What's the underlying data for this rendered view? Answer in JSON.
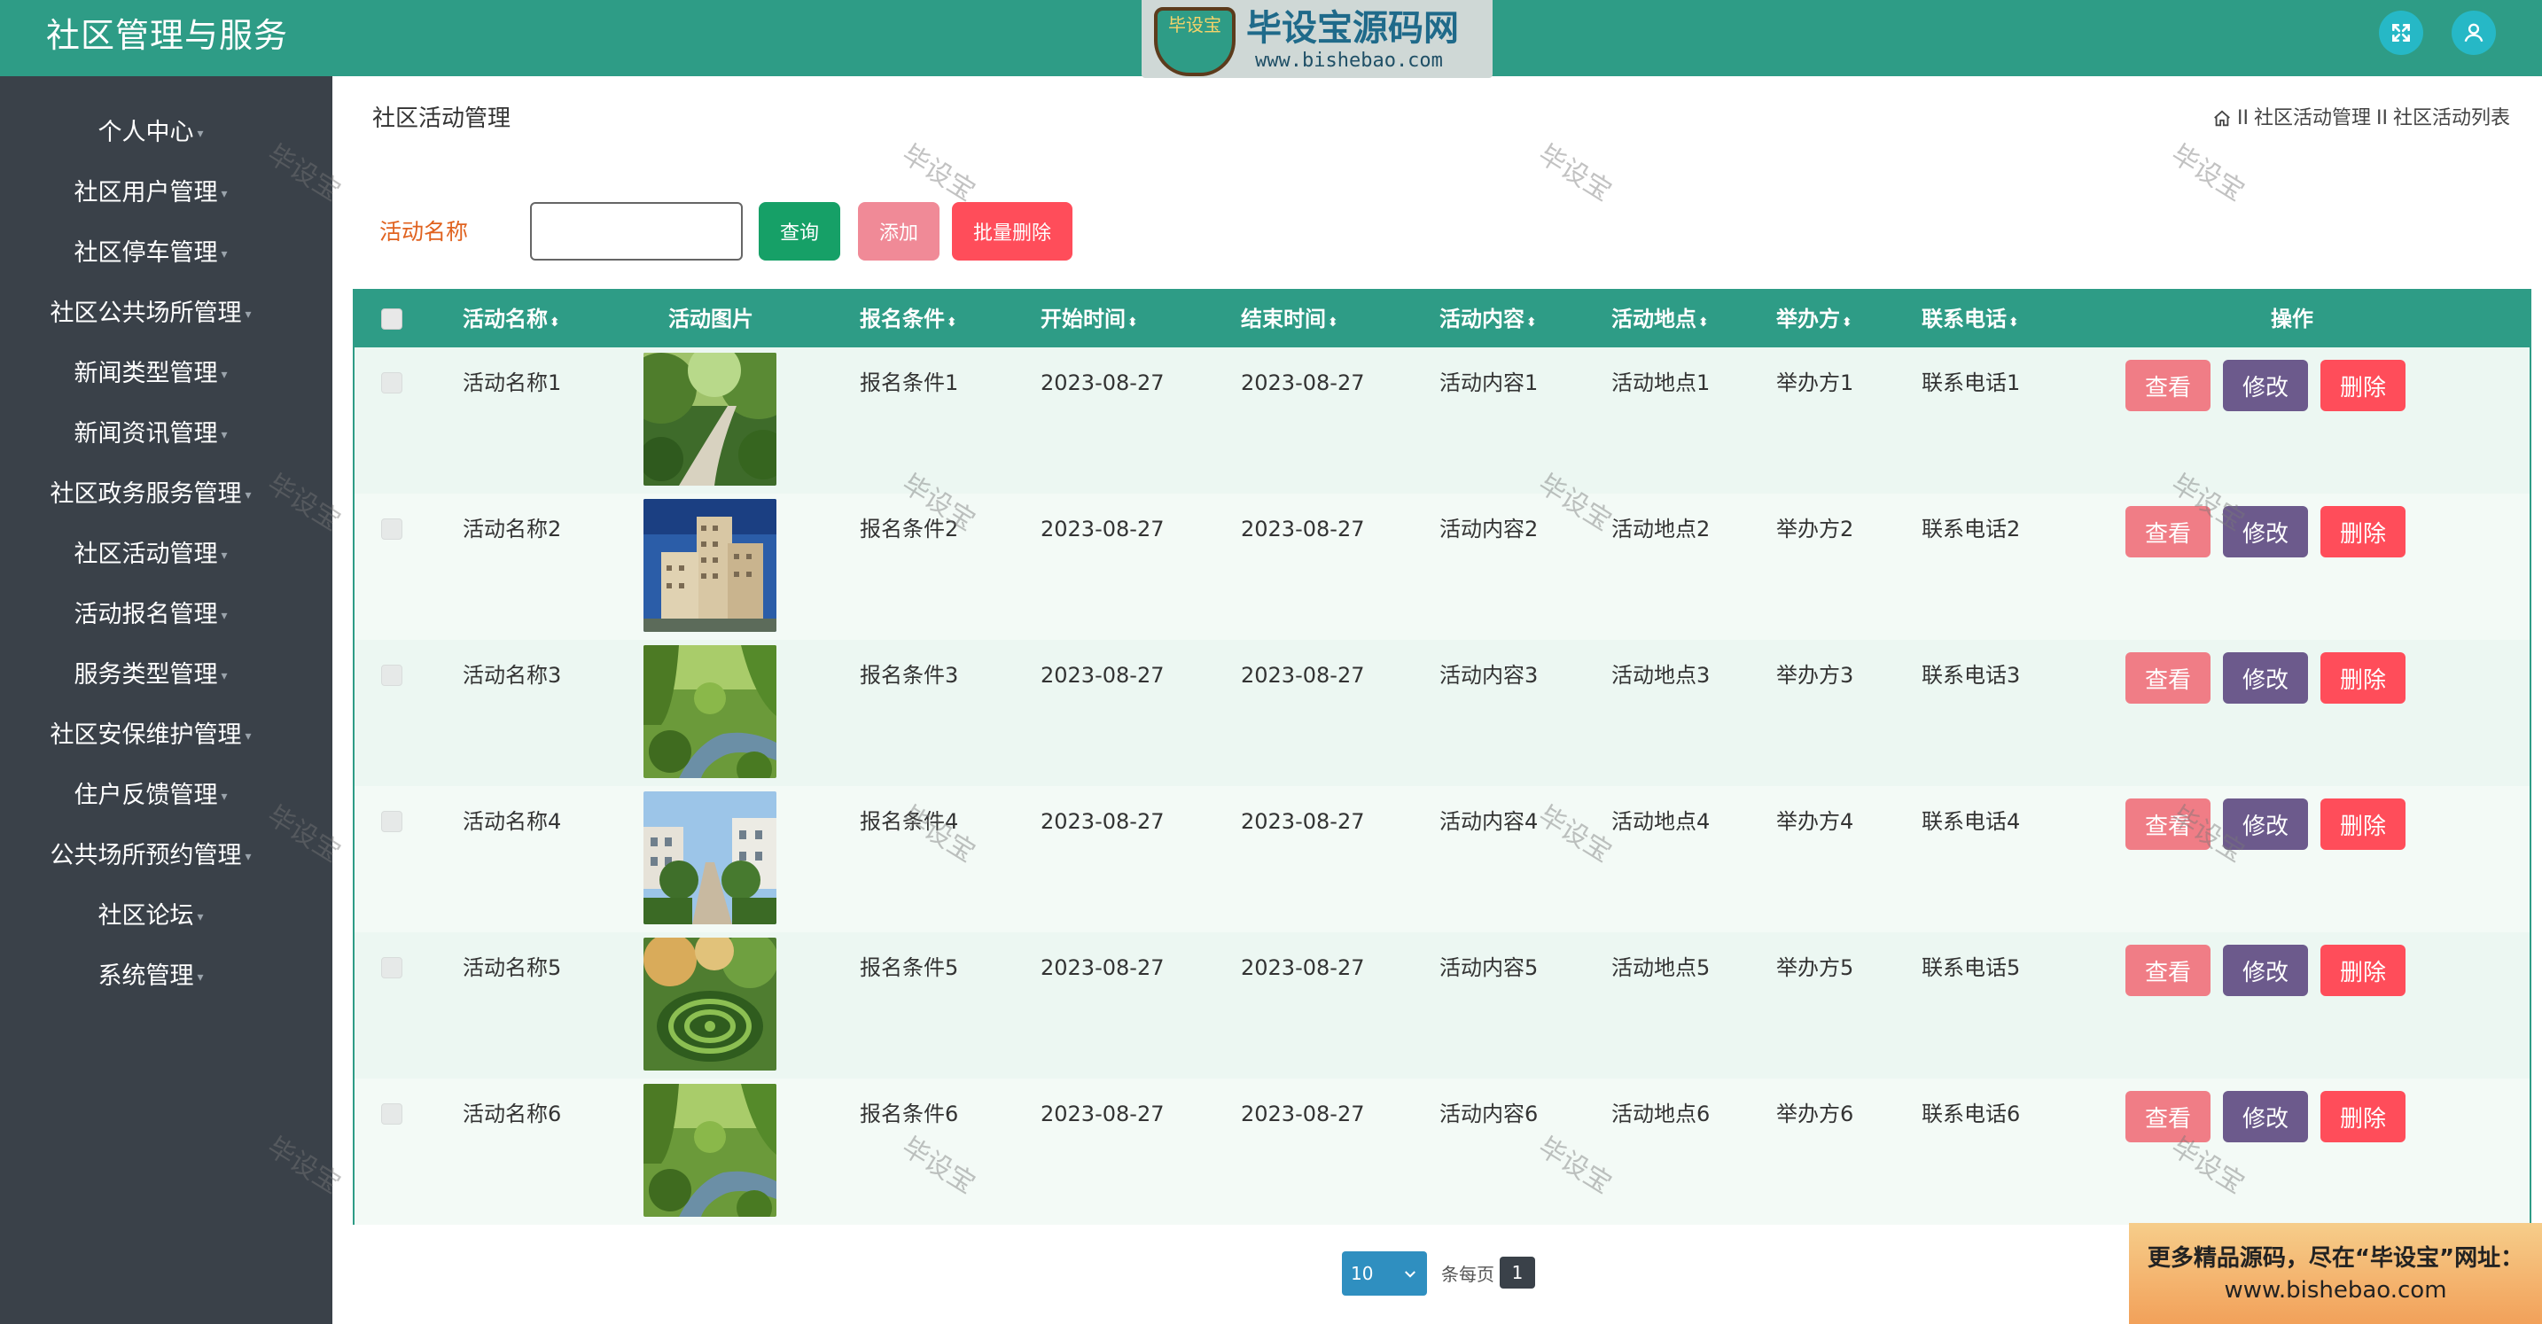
{
  "header": {
    "title": "社区管理与服务",
    "watermark_badge": "毕设宝",
    "watermark_name": "毕设宝源码网",
    "watermark_url": "www.bishebao.com",
    "fullscreen_icon": "expand-icon",
    "user_icon": "user-icon",
    "color": "#2e9c86"
  },
  "sidebar": {
    "items": [
      {
        "label": "个人中心"
      },
      {
        "label": "社区用户管理"
      },
      {
        "label": "社区停车管理"
      },
      {
        "label": "社区公共场所管理"
      },
      {
        "label": "新闻类型管理"
      },
      {
        "label": "新闻资讯管理"
      },
      {
        "label": "社区政务服务管理"
      },
      {
        "label": "社区活动管理"
      },
      {
        "label": "活动报名管理"
      },
      {
        "label": "服务类型管理"
      },
      {
        "label": "社区安保维护管理"
      },
      {
        "label": "住户反馈管理"
      },
      {
        "label": "公共场所预约管理"
      },
      {
        "label": "社区论坛"
      },
      {
        "label": "系统管理"
      }
    ]
  },
  "page": {
    "title": "社区活动管理",
    "breadcrumb": [
      "社区活动管理",
      "社区活动列表"
    ],
    "breadcrumb_sep": "II",
    "home_icon": "home-icon"
  },
  "search": {
    "label": "活动名称",
    "value": "",
    "placeholder": "",
    "query_label": "查询",
    "add_label": "添加",
    "batch_delete_label": "批量删除"
  },
  "table": {
    "columns": [
      "活动名称",
      "活动图片",
      "报名条件",
      "开始时间",
      "结束时间",
      "活动内容",
      "活动地点",
      "举办方",
      "联系电话",
      "操作"
    ],
    "sort_icon": "sort-icon",
    "rows": [
      {
        "name": "活动名称1",
        "image": "garden-path",
        "condition": "报名条件1",
        "start": "2023-08-27",
        "end": "2023-08-27",
        "content": "活动内容1",
        "place": "活动地点1",
        "host": "举办方1",
        "phone": "联系电话1"
      },
      {
        "name": "活动名称2",
        "image": "apartment-building",
        "condition": "报名条件2",
        "start": "2023-08-27",
        "end": "2023-08-27",
        "content": "活动内容2",
        "place": "活动地点2",
        "host": "举办方2",
        "phone": "联系电话2"
      },
      {
        "name": "活动名称3",
        "image": "willow-stream",
        "condition": "报名条件3",
        "start": "2023-08-27",
        "end": "2023-08-27",
        "content": "活动内容3",
        "place": "活动地点3",
        "host": "举办方3",
        "phone": "联系电话3"
      },
      {
        "name": "活动名称4",
        "image": "residential-street",
        "condition": "报名条件4",
        "start": "2023-08-27",
        "end": "2023-08-27",
        "content": "活动内容4",
        "place": "活动地点4",
        "host": "举办方4",
        "phone": "联系电话4"
      },
      {
        "name": "活动名称5",
        "image": "maze-garden",
        "condition": "报名条件5",
        "start": "2023-08-27",
        "end": "2023-08-27",
        "content": "活动内容5",
        "place": "活动地点5",
        "host": "举办方5",
        "phone": "联系电话5"
      },
      {
        "name": "活动名称6",
        "image": "willow-stream",
        "condition": "报名条件6",
        "start": "2023-08-27",
        "end": "2023-08-27",
        "content": "活动内容6",
        "place": "活动地点6",
        "host": "举办方6",
        "phone": "联系电话6"
      }
    ],
    "view_label": "查看",
    "edit_label": "修改",
    "delete_label": "删除"
  },
  "watermark_text": "毕设宝",
  "pagination": {
    "page_size": "10",
    "per_page_label": "条每页",
    "current_page": "1"
  },
  "promo": {
    "line1": "更多精品源码，尽在“毕设宝”网址：",
    "line2": "www.bishebao.com"
  },
  "colors": {
    "primary": "#2e9c86",
    "sidebar_bg": "#3a4149",
    "query_btn": "#16a067",
    "add_btn": "#f08a97",
    "batch_delete_btn": "#ff4d5a",
    "view_btn": "#f07d86",
    "edit_btn": "#6c5a8c",
    "delete_btn": "#ff4d5a",
    "label_orange": "#e0621f"
  }
}
